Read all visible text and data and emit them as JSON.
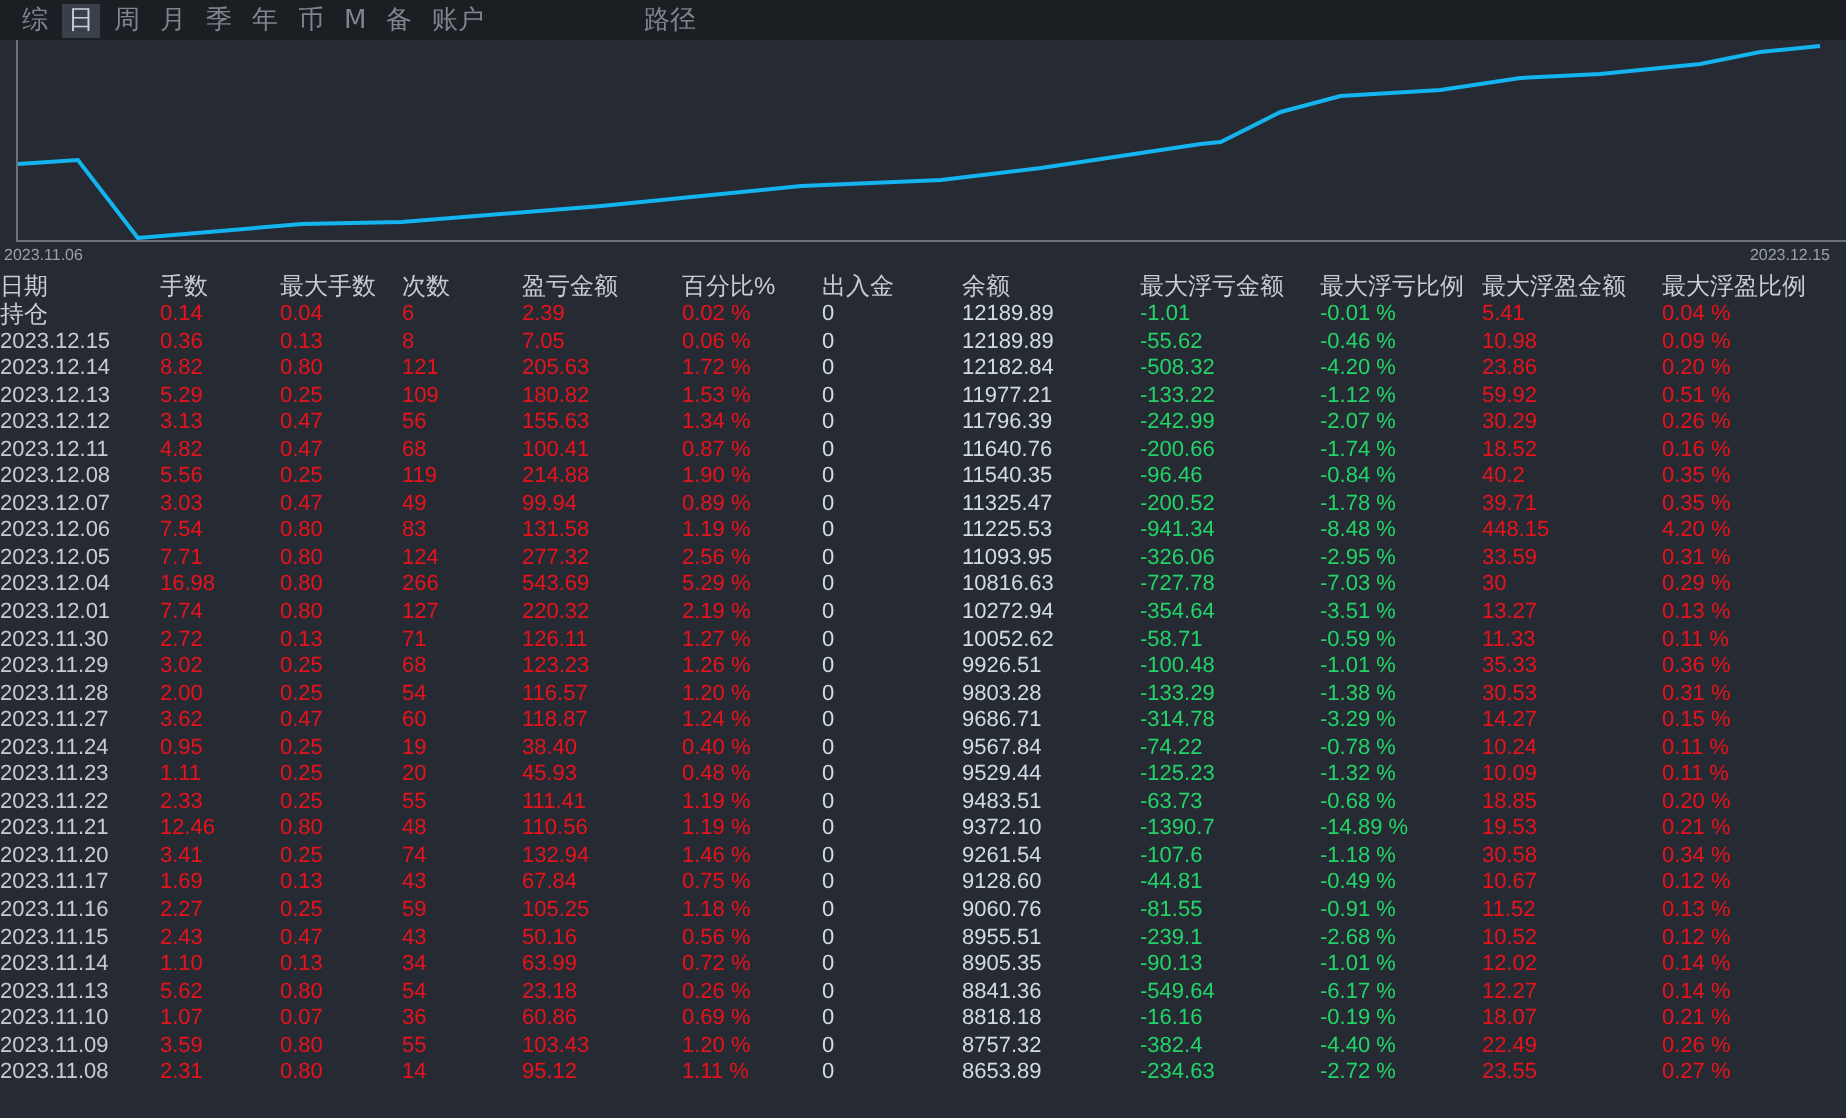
{
  "tabs": [
    {
      "label": "综",
      "selected": false
    },
    {
      "label": "日",
      "selected": true
    },
    {
      "label": "周",
      "selected": false
    },
    {
      "label": "月",
      "selected": false
    },
    {
      "label": "季",
      "selected": false
    },
    {
      "label": "年",
      "selected": false
    },
    {
      "label": "币",
      "selected": false
    },
    {
      "label": "M",
      "selected": false
    },
    {
      "label": "备",
      "selected": false
    },
    {
      "label": "账户",
      "selected": false
    }
  ],
  "extra_tab": {
    "label": "路径",
    "selected": false
  },
  "chart": {
    "start_label": "2023.11.06",
    "end_label": "2023.12.15"
  },
  "table": {
    "columns": [
      {
        "label": "日期",
        "color": "#c8ccd2"
      },
      {
        "label": "手数",
        "color": "#e8121c"
      },
      {
        "label": "最大手数",
        "color": "#e8121c"
      },
      {
        "label": "次数",
        "color": "#e8121c"
      },
      {
        "label": "盈亏金额",
        "color": "#e8121c"
      },
      {
        "label": "百分比%",
        "color": "#e8121c"
      },
      {
        "label": "出入金",
        "color": "#d2dae4"
      },
      {
        "label": "余额",
        "color": "#d2dae4"
      },
      {
        "label": "最大浮亏金额",
        "color": "#22d468"
      },
      {
        "label": "最大浮亏比例",
        "color": "#22d468"
      },
      {
        "label": "最大浮盈金额",
        "color": "#e8121c"
      },
      {
        "label": "最大浮盈比例",
        "color": "#e8121c"
      }
    ],
    "rows": [
      [
        "持仓",
        "0.14",
        "0.04",
        "6",
        "2.39",
        "0.02 %",
        "0",
        "12189.89",
        "-1.01",
        "-0.01 %",
        "5.41",
        "0.04 %"
      ],
      [
        "2023.12.15",
        "0.36",
        "0.13",
        "8",
        "7.05",
        "0.06 %",
        "0",
        "12189.89",
        "-55.62",
        "-0.46 %",
        "10.98",
        "0.09 %"
      ],
      [
        "2023.12.14",
        "8.82",
        "0.80",
        "121",
        "205.63",
        "1.72 %",
        "0",
        "12182.84",
        "-508.32",
        "-4.20 %",
        "23.86",
        "0.20 %"
      ],
      [
        "2023.12.13",
        "5.29",
        "0.25",
        "109",
        "180.82",
        "1.53 %",
        "0",
        "11977.21",
        "-133.22",
        "-1.12 %",
        "59.92",
        "0.51 %"
      ],
      [
        "2023.12.12",
        "3.13",
        "0.47",
        "56",
        "155.63",
        "1.34 %",
        "0",
        "11796.39",
        "-242.99",
        "-2.07 %",
        "30.29",
        "0.26 %"
      ],
      [
        "2023.12.11",
        "4.82",
        "0.47",
        "68",
        "100.41",
        "0.87 %",
        "0",
        "11640.76",
        "-200.66",
        "-1.74 %",
        "18.52",
        "0.16 %"
      ],
      [
        "2023.12.08",
        "5.56",
        "0.25",
        "119",
        "214.88",
        "1.90 %",
        "0",
        "11540.35",
        "-96.46",
        "-0.84 %",
        "40.2",
        "0.35 %"
      ],
      [
        "2023.12.07",
        "3.03",
        "0.47",
        "49",
        "99.94",
        "0.89 %",
        "0",
        "11325.47",
        "-200.52",
        "-1.78 %",
        "39.71",
        "0.35 %"
      ],
      [
        "2023.12.06",
        "7.54",
        "0.80",
        "83",
        "131.58",
        "1.19 %",
        "0",
        "11225.53",
        "-941.34",
        "-8.48 %",
        "448.15",
        "4.20 %"
      ],
      [
        "2023.12.05",
        "7.71",
        "0.80",
        "124",
        "277.32",
        "2.56 %",
        "0",
        "11093.95",
        "-326.06",
        "-2.95 %",
        "33.59",
        "0.31 %"
      ],
      [
        "2023.12.04",
        "16.98",
        "0.80",
        "266",
        "543.69",
        "5.29 %",
        "0",
        "10816.63",
        "-727.78",
        "-7.03 %",
        "30",
        "0.29 %"
      ],
      [
        "2023.12.01",
        "7.74",
        "0.80",
        "127",
        "220.32",
        "2.19 %",
        "0",
        "10272.94",
        "-354.64",
        "-3.51 %",
        "13.27",
        "0.13 %"
      ],
      [
        "2023.11.30",
        "2.72",
        "0.13",
        "71",
        "126.11",
        "1.27 %",
        "0",
        "10052.62",
        "-58.71",
        "-0.59 %",
        "11.33",
        "0.11 %"
      ],
      [
        "2023.11.29",
        "3.02",
        "0.25",
        "68",
        "123.23",
        "1.26 %",
        "0",
        "9926.51",
        "-100.48",
        "-1.01 %",
        "35.33",
        "0.36 %"
      ],
      [
        "2023.11.28",
        "2.00",
        "0.25",
        "54",
        "116.57",
        "1.20 %",
        "0",
        "9803.28",
        "-133.29",
        "-1.38 %",
        "30.53",
        "0.31 %"
      ],
      [
        "2023.11.27",
        "3.62",
        "0.47",
        "60",
        "118.87",
        "1.24 %",
        "0",
        "9686.71",
        "-314.78",
        "-3.29 %",
        "14.27",
        "0.15 %"
      ],
      [
        "2023.11.24",
        "0.95",
        "0.25",
        "19",
        "38.40",
        "0.40 %",
        "0",
        "9567.84",
        "-74.22",
        "-0.78 %",
        "10.24",
        "0.11 %"
      ],
      [
        "2023.11.23",
        "1.11",
        "0.25",
        "20",
        "45.93",
        "0.48 %",
        "0",
        "9529.44",
        "-125.23",
        "-1.32 %",
        "10.09",
        "0.11 %"
      ],
      [
        "2023.11.22",
        "2.33",
        "0.25",
        "55",
        "111.41",
        "1.19 %",
        "0",
        "9483.51",
        "-63.73",
        "-0.68 %",
        "18.85",
        "0.20 %"
      ],
      [
        "2023.11.21",
        "12.46",
        "0.80",
        "48",
        "110.56",
        "1.19 %",
        "0",
        "9372.10",
        "-1390.7",
        "-14.89 %",
        "19.53",
        "0.21 %"
      ],
      [
        "2023.11.20",
        "3.41",
        "0.25",
        "74",
        "132.94",
        "1.46 %",
        "0",
        "9261.54",
        "-107.6",
        "-1.18 %",
        "30.58",
        "0.34 %"
      ],
      [
        "2023.11.17",
        "1.69",
        "0.13",
        "43",
        "67.84",
        "0.75 %",
        "0",
        "9128.60",
        "-44.81",
        "-0.49 %",
        "10.67",
        "0.12 %"
      ],
      [
        "2023.11.16",
        "2.27",
        "0.25",
        "59",
        "105.25",
        "1.18 %",
        "0",
        "9060.76",
        "-81.55",
        "-0.91 %",
        "11.52",
        "0.13 %"
      ],
      [
        "2023.11.15",
        "2.43",
        "0.47",
        "43",
        "50.16",
        "0.56 %",
        "0",
        "8955.51",
        "-239.1",
        "-2.68 %",
        "10.52",
        "0.12 %"
      ],
      [
        "2023.11.14",
        "1.10",
        "0.13",
        "34",
        "63.99",
        "0.72 %",
        "0",
        "8905.35",
        "-90.13",
        "-1.01 %",
        "12.02",
        "0.14 %"
      ],
      [
        "2023.11.13",
        "5.62",
        "0.80",
        "54",
        "23.18",
        "0.26 %",
        "0",
        "8841.36",
        "-549.64",
        "-6.17 %",
        "12.27",
        "0.14 %"
      ],
      [
        "2023.11.10",
        "1.07",
        "0.07",
        "36",
        "60.86",
        "0.69 %",
        "0",
        "8818.18",
        "-16.16",
        "-0.19 %",
        "18.07",
        "0.21 %"
      ],
      [
        "2023.11.09",
        "3.59",
        "0.80",
        "55",
        "103.43",
        "1.20 %",
        "0",
        "8757.32",
        "-382.4",
        "-4.40 %",
        "22.49",
        "0.26 %"
      ],
      [
        "2023.11.08",
        "2.31",
        "0.80",
        "14",
        "95.12",
        "1.11 %",
        "0",
        "8653.89",
        "-234.63",
        "-2.72 %",
        "23.55",
        "0.27 %"
      ]
    ]
  }
}
